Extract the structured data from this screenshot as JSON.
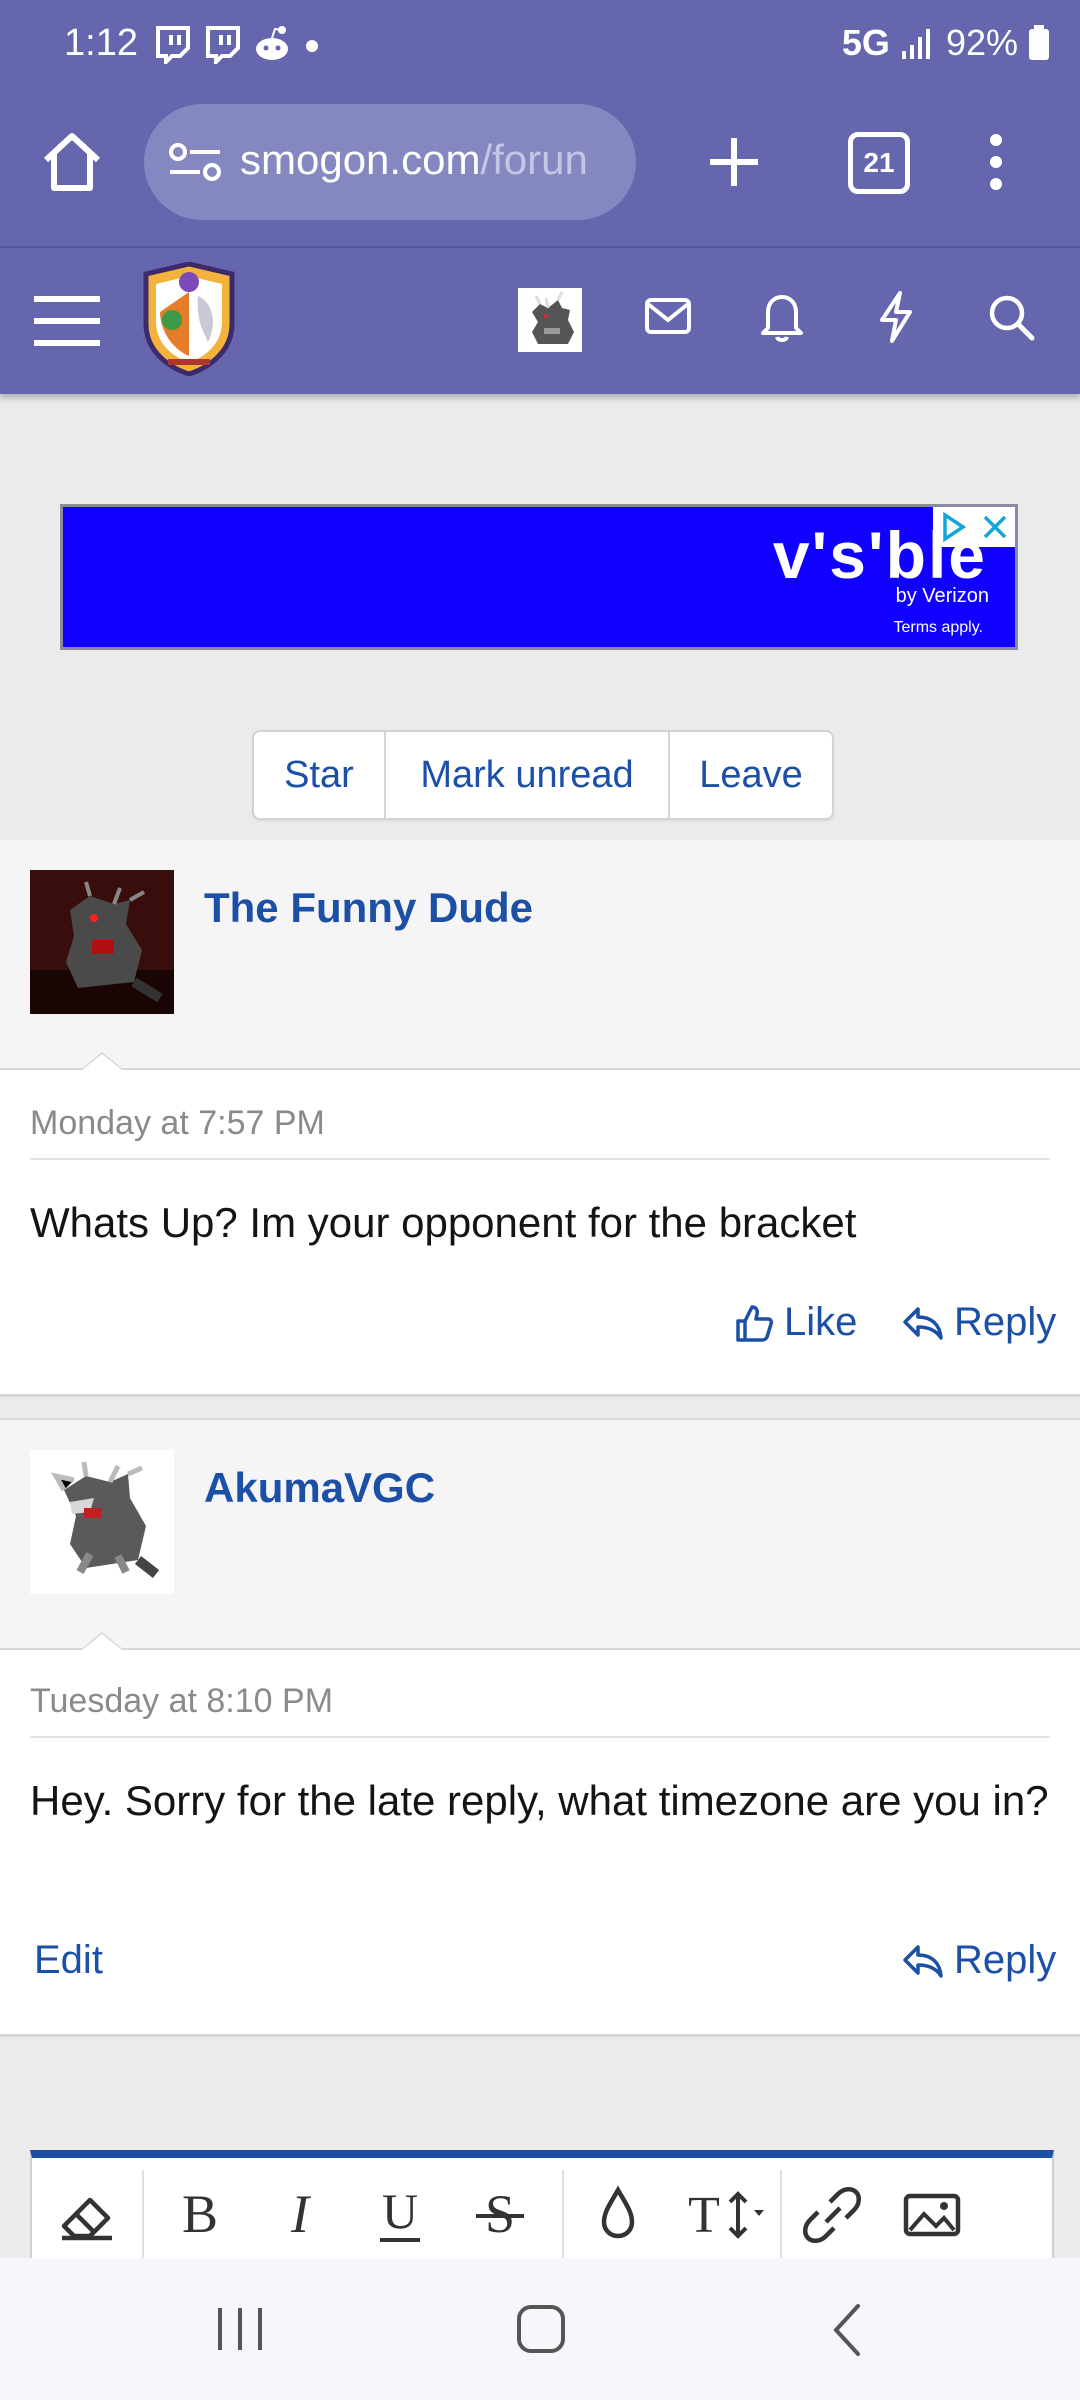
{
  "status_bar": {
    "time": "1:12",
    "network": "5G",
    "battery": "92%"
  },
  "browser": {
    "url_host": "smogon.com",
    "url_path": "/forun",
    "tab_count": "21"
  },
  "ad": {
    "brand": "v's'ble",
    "sub": "by Verizon",
    "terms": "Terms apply."
  },
  "thread_actions": [
    "Star",
    "Mark unread",
    "Leave"
  ],
  "messages": [
    {
      "username": "The Funny Dude",
      "date": "Monday at 7:57 PM",
      "body": "Whats Up? Im your opponent for the bracket",
      "like_label": "Like",
      "reply_label": "Reply"
    },
    {
      "username": "AkumaVGC",
      "date": "Tuesday at 8:10 PM",
      "body": "Hey. Sorry for the late reply, what timezone are you in?",
      "edit_label": "Edit",
      "reply_label": "Reply"
    }
  ],
  "editor_tools": [
    "eraser-icon",
    "bold-icon",
    "italic-icon",
    "underline-icon",
    "strike-icon",
    "color-icon",
    "text-size-icon",
    "link-icon",
    "image-icon"
  ],
  "colors": {
    "header": "#6566ad",
    "link": "#1c50a6",
    "ad_bg": "#1000ff"
  }
}
